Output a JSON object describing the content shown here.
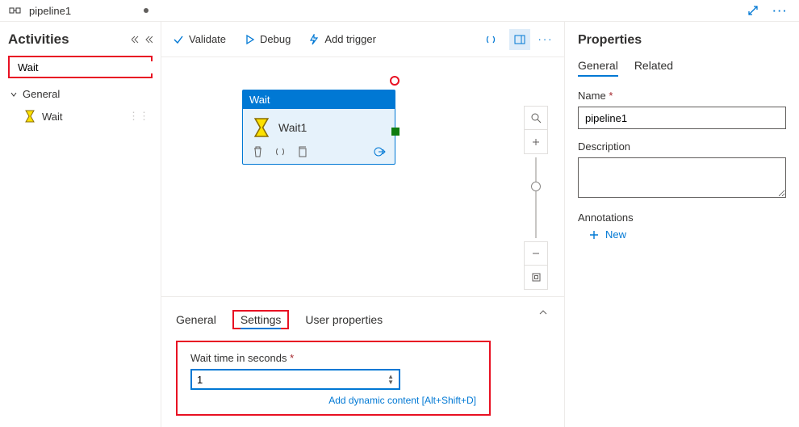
{
  "topbar": {
    "title": "pipeline1"
  },
  "sidebar": {
    "title": "Activities",
    "search_value": "Wait",
    "group": "General",
    "activity": "Wait"
  },
  "toolbar": {
    "validate": "Validate",
    "debug": "Debug",
    "add_trigger": "Add trigger"
  },
  "node": {
    "type": "Wait",
    "name": "Wait1"
  },
  "bottom": {
    "tabs": {
      "general": "General",
      "settings": "Settings",
      "user_props": "User properties"
    },
    "field_label": "Wait time in seconds",
    "value": "1",
    "dyn_link": "Add dynamic content [Alt+Shift+D]"
  },
  "props": {
    "title": "Properties",
    "tabs": {
      "general": "General",
      "related": "Related"
    },
    "name_label": "Name",
    "name_value": "pipeline1",
    "desc_label": "Description",
    "desc_value": "",
    "anno_label": "Annotations",
    "new_label": "New"
  }
}
